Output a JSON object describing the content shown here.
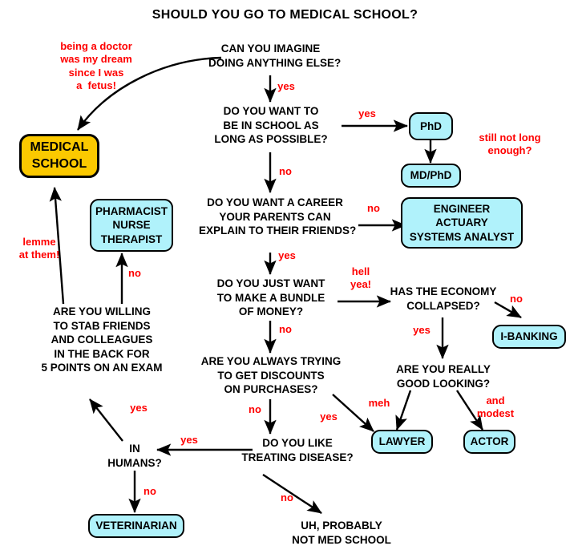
{
  "title": "SHOULD YOU GO TO MEDICAL SCHOOL?",
  "colors": {
    "terminal_fill": "#b0f2fb",
    "medical_school_fill": "#fbc900",
    "edge_label": "#ff0000",
    "text": "#000000",
    "background": "#ffffff"
  },
  "questions": {
    "imagine": "CAN YOU IMAGINE\nDOING ANYTHING ELSE?",
    "school_long": "DO YOU WANT TO\nBE IN SCHOOL AS\nLONG AS POSSIBLE?",
    "parents_explain": "DO YOU WANT A CAREER\nYOUR PARENTS CAN\nEXPLAIN TO THEIR FRIENDS?",
    "bundle_money": "DO YOU JUST WANT\nTO MAKE A BUNDLE\nOF MONEY?",
    "economy": "HAS THE ECONOMY\nCOLLAPSED?",
    "good_looking": "ARE YOU REALLY\nGOOD LOOKING?",
    "discounts": "ARE YOU ALWAYS TRYING\nTO GET DISCOUNTS\nON PURCHASES?",
    "treating_disease": "DO YOU LIKE\nTREATING DISEASE?",
    "stab_friends": "ARE YOU WILLING\nTO STAB FRIENDS\nAND COLLEAGUES\nIN THE BACK FOR\n5 POINTS ON AN EXAM",
    "in_humans": "IN\nHUMANS?",
    "not_med_school": "UH, PROBABLY\nNOT MED SCHOOL"
  },
  "nodes": {
    "medical_school": {
      "lines": [
        "MEDICAL",
        "SCHOOL"
      ]
    },
    "pharmacist": {
      "lines": [
        "PHARMACIST",
        "NURSE",
        "THERAPIST"
      ]
    },
    "phd": {
      "lines": [
        "PhD"
      ]
    },
    "mdphd": {
      "lines": [
        "MD/PhD"
      ]
    },
    "engineer": {
      "lines": [
        "ENGINEER",
        "ACTUARY",
        "SYSTEMS ANALYST"
      ]
    },
    "ibanking": {
      "lines": [
        "I-BANKING"
      ]
    },
    "lawyer": {
      "lines": [
        "LAWYER"
      ]
    },
    "actor": {
      "lines": [
        "ACTOR"
      ]
    },
    "veterinarian": {
      "lines": [
        "VETERINARIAN"
      ]
    }
  },
  "edge_labels": {
    "being_a_doctor": "being a doctor\nwas my dream\nsince I was\na  fetus!",
    "imagine_yes": "yes",
    "school_long_yes": "yes",
    "school_long_no": "no",
    "still_not_long": "still not long\nenough?",
    "parents_no": "no",
    "parents_yes": "yes",
    "hell_yea": "hell\nyea!",
    "money_no": "no",
    "economy_yes": "yes",
    "economy_no": "no",
    "meh": "meh",
    "and_modest": "and\nmodest",
    "discounts_yes": "yes",
    "discounts_no": "no",
    "disease_yes": "yes",
    "disease_no": "no",
    "humans_yes": "yes",
    "humans_no": "no",
    "stab_yes": "yes",
    "pharmacist_no": "no",
    "lemme_at_them": "lemme\nat them!"
  }
}
